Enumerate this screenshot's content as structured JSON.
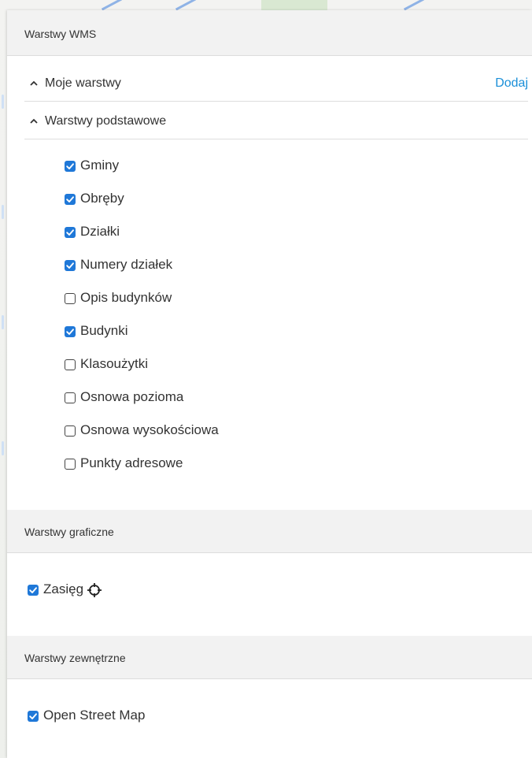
{
  "sections": {
    "wms_title": "Warstwy WMS",
    "graficzne_title": "Warstwy graficzne",
    "zewnetrzne_title": "Warstwy zewnętrzne"
  },
  "groups": {
    "moje": {
      "label": "Moje warstwy",
      "add_label": "Dodaj",
      "expanded": true
    },
    "podstawowe": {
      "label": "Warstwy podstawowe",
      "expanded": true
    }
  },
  "base_layers": [
    {
      "label": "Gminy",
      "checked": true
    },
    {
      "label": "Obręby",
      "checked": true
    },
    {
      "label": "Działki",
      "checked": true
    },
    {
      "label": "Numery działek",
      "checked": true
    },
    {
      "label": "Opis budynków",
      "checked": false
    },
    {
      "label": "Budynki",
      "checked": true
    },
    {
      "label": "Klasoużytki",
      "checked": false
    },
    {
      "label": "Osnowa pozioma",
      "checked": false
    },
    {
      "label": "Osnowa wysokościowa",
      "checked": false
    },
    {
      "label": "Punkty adresowe",
      "checked": false
    }
  ],
  "graphic_layers": [
    {
      "label": "Zasięg",
      "checked": true,
      "icon": "crosshair-icon"
    }
  ],
  "external_layers": [
    {
      "label": "Open Street Map",
      "checked": true
    }
  ],
  "colors": {
    "accent": "#1f78d8",
    "link": "#1a8fd8",
    "header_bg": "#f2f2f2"
  }
}
